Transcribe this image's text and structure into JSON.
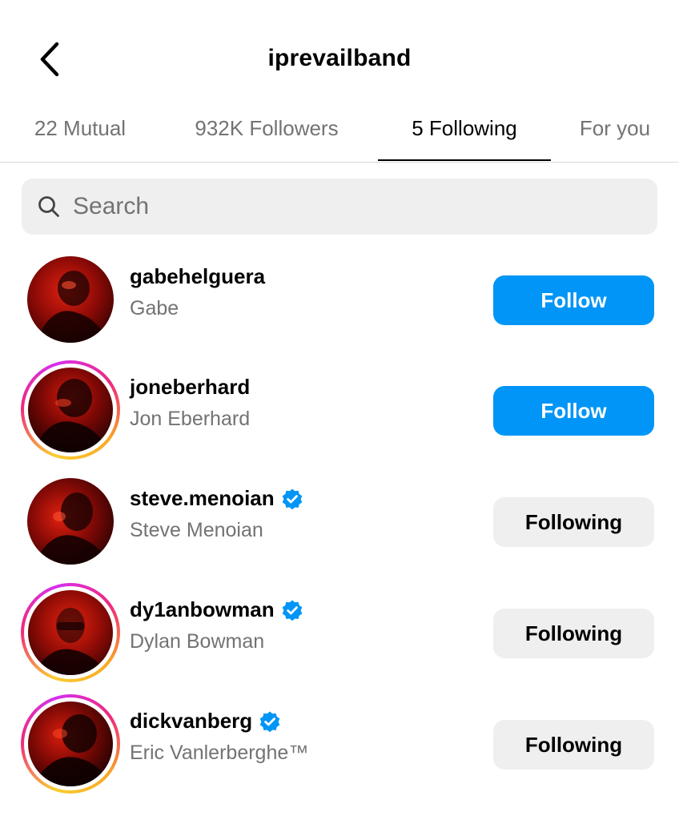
{
  "header": {
    "title": "iprevailband",
    "back_icon": "chevron-left-icon"
  },
  "tabs": [
    {
      "label": "22 Mutual",
      "active": false
    },
    {
      "label": "932K Followers",
      "active": false
    },
    {
      "label": "5 Following",
      "active": true
    },
    {
      "label": "For you",
      "active": false
    }
  ],
  "search": {
    "placeholder": "Search",
    "icon": "search-icon"
  },
  "accounts": [
    {
      "username": "gabehelguera",
      "name": "Gabe",
      "verified": false,
      "story_ring": false,
      "button": "Follow"
    },
    {
      "username": "joneberhard",
      "name": "Jon Eberhard",
      "verified": false,
      "story_ring": true,
      "button": "Follow"
    },
    {
      "username": "steve.menoian",
      "name": "Steve Menoian",
      "verified": true,
      "story_ring": false,
      "button": "Following"
    },
    {
      "username": "dy1anbowman",
      "name": "Dylan Bowman",
      "verified": true,
      "story_ring": true,
      "button": "Following"
    },
    {
      "username": "dickvanberg",
      "name": "Eric Vanlerberghe™",
      "verified": true,
      "story_ring": true,
      "button": "Following"
    }
  ],
  "colors": {
    "accent": "#0095f6",
    "secondary_text": "#737373",
    "button_gray": "#efefef",
    "verified_badge": "#0095f6"
  }
}
